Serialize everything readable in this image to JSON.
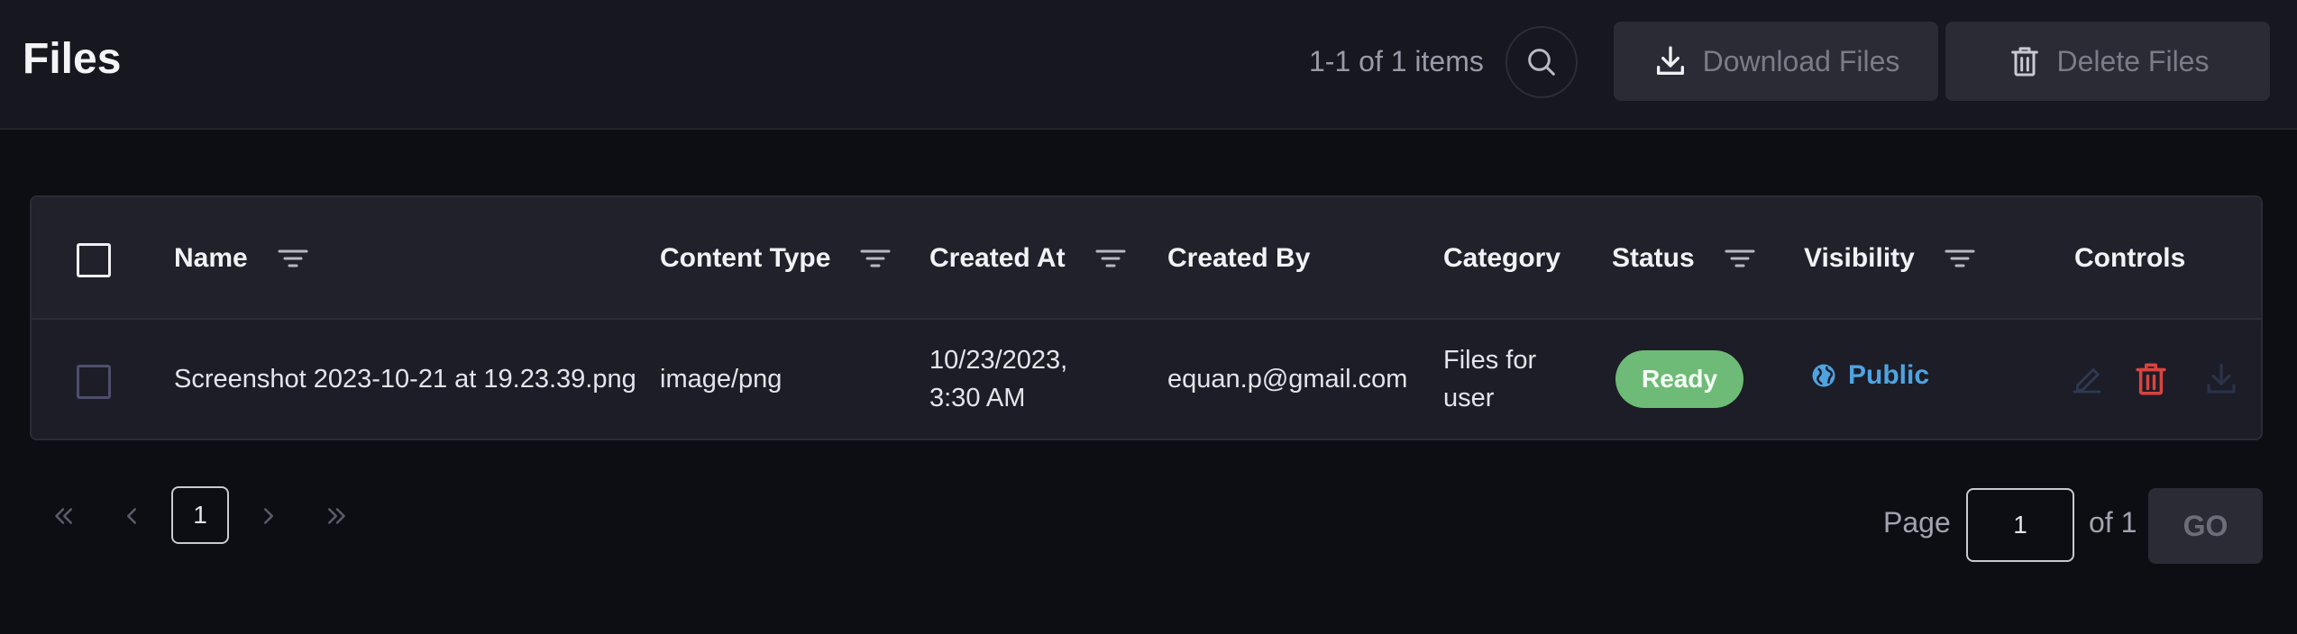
{
  "header": {
    "title": "Files",
    "items_count": "1-1 of 1 items",
    "download_label": "Download Files",
    "delete_label": "Delete Files"
  },
  "table": {
    "columns": {
      "name": "Name",
      "content_type": "Content Type",
      "created_at": "Created At",
      "created_by": "Created By",
      "category": "Category",
      "status": "Status",
      "visibility": "Visibility",
      "controls": "Controls"
    },
    "rows": [
      {
        "name": "Screenshot 2023-10-21 at 19.23.39.png",
        "content_type": "image/png",
        "created_at_date": "10/23/2023,",
        "created_at_time": "3:30 AM",
        "created_by": "equan.p@gmail.com",
        "category_line1": "Files for",
        "category_line2": "user",
        "status": "Ready",
        "visibility": "Public"
      }
    ]
  },
  "pagination": {
    "current_page": "1",
    "page_label": "Page",
    "page_input_value": "1",
    "of_label": "of 1",
    "go_label": "GO"
  },
  "colors": {
    "background": "#0d0e13",
    "header_bg": "#16171f",
    "status_ready": "#6dbb76",
    "visibility_public": "#4fa3e0",
    "delete_red": "#d9443f"
  },
  "icons": {
    "search": "search-icon",
    "download": "download-icon",
    "trash": "trash-icon",
    "filter": "filter-icon",
    "globe": "globe-icon",
    "edit": "edit-icon",
    "first_page": "chevrons-left-icon",
    "prev_page": "chevron-left-icon",
    "next_page": "chevron-right-icon",
    "last_page": "chevrons-right-icon"
  }
}
